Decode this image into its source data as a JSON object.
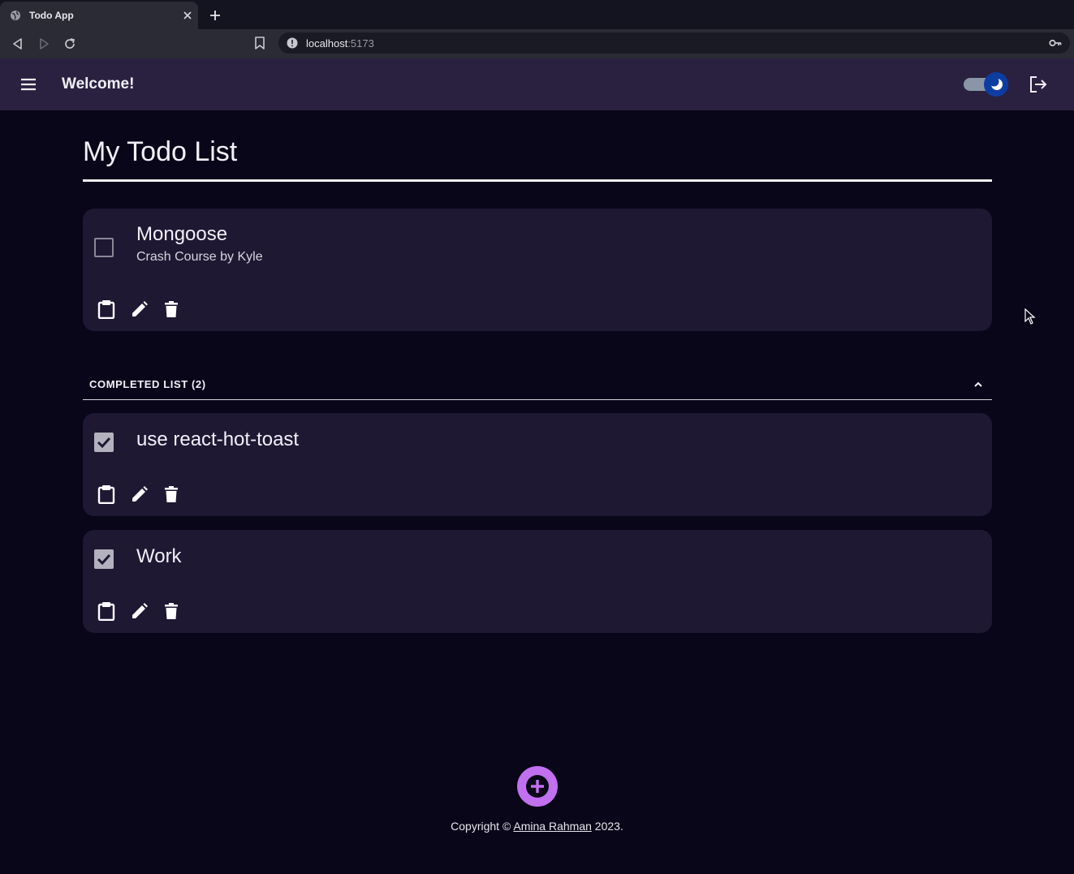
{
  "browser": {
    "tab_title": "Todo App",
    "url_host": "localhost",
    "url_port": ":5173"
  },
  "appbar": {
    "title": "Welcome!",
    "theme_mode": "dark"
  },
  "main": {
    "page_title": "My Todo List",
    "active_todos": [
      {
        "title": "Mongoose",
        "description": "Crash Course by Kyle",
        "completed": false
      }
    ],
    "completed_section_label": "COMPLETED LIST (2)",
    "completed_todos": [
      {
        "title": "use react-hot-toast",
        "completed": true
      },
      {
        "title": "Work",
        "completed": true
      }
    ]
  },
  "footer": {
    "prefix": "Copyright © ",
    "author": "Amina Rahman",
    "suffix": " 2023."
  },
  "colors": {
    "background": "#080618",
    "appbar": "#2a2140",
    "card": "#1e1833",
    "fab": "#c170f0",
    "toggle_thumb": "#0d3da0"
  }
}
